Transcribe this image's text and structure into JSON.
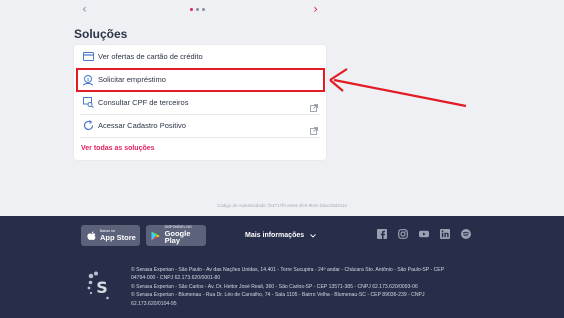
{
  "carousel": {
    "prev_icon": "chevron-left-icon",
    "next_icon": "chevron-right-icon"
  },
  "solutions": {
    "title": "Soluções",
    "items": [
      {
        "label": "Ver ofertas de cartão de crédito",
        "icon": "credit-card-icon",
        "external": false
      },
      {
        "label": "Solicitar empréstimo",
        "icon": "money-hand-icon",
        "external": false
      },
      {
        "label": "Consultar CPF de terceiros",
        "icon": "document-search-icon",
        "external": true
      },
      {
        "label": "Acessar Cadastro Positivo",
        "icon": "refresh-circle-icon",
        "external": true
      }
    ],
    "see_all": "Ver todas as soluções"
  },
  "auth_code": "Código de Autenticidade: fb4717f0-ae94-4fc9-9b4c-b5ac25d311e",
  "footer": {
    "app_store": {
      "small": "Baixar na",
      "big": "App Store"
    },
    "google_play": {
      "small": "DISPONÍVEL NO",
      "big": "Google Play"
    },
    "more_info": "Mais informações",
    "social": [
      "facebook-icon",
      "instagram-icon",
      "youtube-icon",
      "linkedin-icon",
      "spotify-icon"
    ],
    "legal": [
      "© Serasa Experian - São Paulo - Av das Nações Unidas, 14.401 - Torre Sucupira - 24º andar - Chácara Sto. Antônio - São Paulo-SP - CEP 04794-000 - CNPJ 62.173.620/0001-80",
      "© Serasa Experian - São Carlos - Av. Dr. Heitor José Reali, 360 - São Carlos-SP - CEP 13571-385 - CNPJ 62.173.620/0093-06",
      "© Serasa Experian - Blumenau - Rua Dr. Léo de Carvalho, 74 - Sala 1105 - Bairro Velha - Blumenau-SC - CEP 89036-239 - CNPJ 62.173.620/0104-95"
    ]
  },
  "colors": {
    "accent": "#e0245e",
    "highlight": "#e31b23",
    "footer_bg": "#262e4a",
    "icon_blue": "#4a78c8"
  }
}
